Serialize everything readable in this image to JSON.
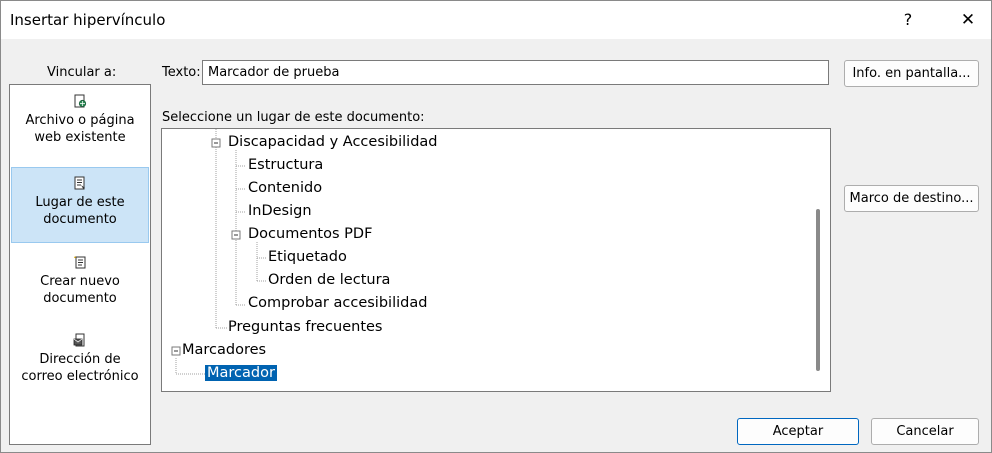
{
  "dialog": {
    "title": "Insertar hipervínculo",
    "help": "?",
    "close": "✕"
  },
  "link_to": {
    "label": "Vincular a:",
    "items": [
      {
        "line1": "Archivo o página",
        "line2": "web existente",
        "icon": "web-file-icon",
        "selected": false
      },
      {
        "line1": "Lugar de este",
        "line2": "documento",
        "icon": "place-in-document-icon",
        "selected": true
      },
      {
        "line1": "Crear nuevo",
        "line2": "documento",
        "icon": "new-document-icon",
        "selected": false
      },
      {
        "line1": "Dirección de",
        "line2": "correo electrónico",
        "icon": "email-address-icon",
        "selected": false
      }
    ]
  },
  "text_field": {
    "label": "Texto:",
    "value": "Marcador de prueba"
  },
  "screen_tip_button": "Info. en pantalla...",
  "place_label": "Seleccione un lugar de este documento:",
  "tree": [
    {
      "label": "Discapacidad y Accesibilidad",
      "expander": "minus"
    },
    {
      "label": "Estructura"
    },
    {
      "label": "Contenido"
    },
    {
      "label": "InDesign"
    },
    {
      "label": "Documentos PDF",
      "expander": "minus"
    },
    {
      "label": "Etiquetado"
    },
    {
      "label": "Orden de lectura"
    },
    {
      "label": "Comprobar accesibilidad"
    },
    {
      "label": "Preguntas frecuentes"
    },
    {
      "label": "Marcadores",
      "expander": "minus"
    },
    {
      "label": "Marcador",
      "selected": true
    }
  ],
  "target_frame_button": "Marco de destino...",
  "ok_button": "Aceptar",
  "cancel_button": "Cancelar",
  "colors": {
    "selection": "#0063b1",
    "link_selected_bg": "#cce4f7",
    "default_button_border": "#0067c0"
  }
}
